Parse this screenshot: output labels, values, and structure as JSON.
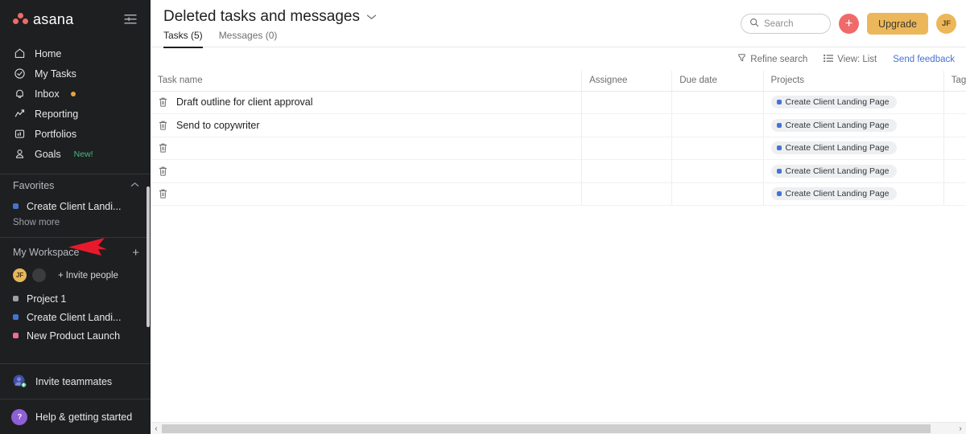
{
  "sidebar": {
    "brand": "asana",
    "collapse_icon": "collapse-sidebar-icon",
    "nav": [
      {
        "label": "Home",
        "icon": "home-icon"
      },
      {
        "label": "My Tasks",
        "icon": "check-circle-icon"
      },
      {
        "label": "Inbox",
        "icon": "bell-icon",
        "dot": true
      },
      {
        "label": "Reporting",
        "icon": "chart-line-icon"
      },
      {
        "label": "Portfolios",
        "icon": "portfolio-icon"
      },
      {
        "label": "Goals",
        "icon": "goal-person-icon",
        "badge": "New!"
      }
    ],
    "favorites": {
      "title": "Favorites",
      "items": [
        {
          "label": "Create Client Landi...",
          "color": "#4573d2"
        }
      ],
      "show_more": "Show more"
    },
    "workspace": {
      "title": "My Workspace",
      "add_icon": "plus-icon",
      "avatars": [
        {
          "initials": "JF"
        },
        {
          "initials": ""
        }
      ],
      "invite_people": "Invite people",
      "projects": [
        {
          "label": "Project 1",
          "color": "#9ca0a8"
        },
        {
          "label": "Create Client Landi...",
          "color": "#4573d2"
        },
        {
          "label": "New Product Launch",
          "color": "#f06a9c"
        }
      ]
    },
    "bottom": [
      {
        "label": "Invite teammates",
        "icon": "invite-teammates-icon"
      },
      {
        "label": "Help & getting started",
        "icon": "help-question-icon"
      }
    ]
  },
  "header": {
    "title": "Deleted tasks and messages",
    "chevron_icon": "chevron-down-icon",
    "tabs": [
      {
        "label": "Tasks (5)",
        "active": true
      },
      {
        "label": "Messages (0)",
        "active": false
      }
    ],
    "search": {
      "placeholder": "Search",
      "icon": "search-icon"
    },
    "create_button": "+",
    "upgrade_button": "Upgrade",
    "avatar": "JF"
  },
  "toolbar": {
    "refine_search": "Refine search",
    "refine_icon": "filter-icon",
    "view": "View: List",
    "view_icon": "list-view-icon",
    "send_feedback": "Send feedback"
  },
  "table": {
    "columns": [
      "Task name",
      "Assignee",
      "Due date",
      "Projects",
      "Tags"
    ],
    "rows": [
      {
        "task": "Draft outline for client approval",
        "assignee": "",
        "due": "",
        "project": "Create Client Landing Page",
        "tags": ""
      },
      {
        "task": "Send to copywriter",
        "assignee": "",
        "due": "",
        "project": "Create Client Landing Page",
        "tags": ""
      },
      {
        "task": "",
        "assignee": "",
        "due": "",
        "project": "Create Client Landing Page",
        "tags": ""
      },
      {
        "task": "",
        "assignee": "",
        "due": "",
        "project": "Create Client Landing Page",
        "tags": ""
      },
      {
        "task": "",
        "assignee": "",
        "due": "",
        "project": "Create Client Landing Page",
        "tags": ""
      }
    ],
    "row_icon": "trash-icon",
    "project_chip_color": "#4573d2"
  },
  "scrollbar": {
    "left_arrow": "‹",
    "right_arrow": "›"
  },
  "annotation": {
    "arrow": "red-arrow-pointing-left",
    "color": "#e8192c"
  },
  "colors": {
    "sidebar_bg": "#1e1f21",
    "accent_red": "#f06a6a",
    "upgrade_yellow": "#ecb75a",
    "link_blue": "#4573d2",
    "new_green": "#4cb782"
  }
}
